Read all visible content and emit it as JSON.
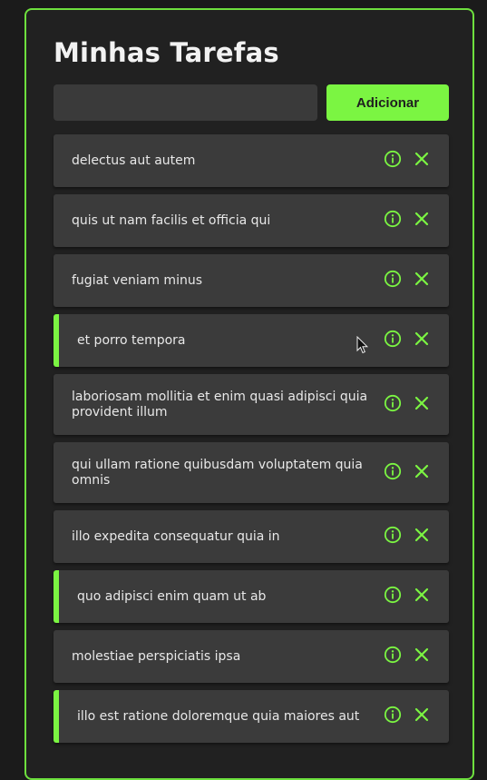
{
  "header": {
    "title": "Minhas Tarefas"
  },
  "form": {
    "input_value": "",
    "input_placeholder": "",
    "add_label": "Adicionar"
  },
  "tasks": [
    {
      "text": "delectus aut autem",
      "completed": false
    },
    {
      "text": "quis ut nam facilis et officia qui",
      "completed": false
    },
    {
      "text": "fugiat veniam minus",
      "completed": false
    },
    {
      "text": "et porro tempora",
      "completed": true
    },
    {
      "text": "laboriosam mollitia et enim quasi adipisci quia provident illum",
      "completed": false
    },
    {
      "text": "qui ullam ratione quibusdam voluptatem quia omnis",
      "completed": false
    },
    {
      "text": "illo expedita consequatur quia in",
      "completed": false
    },
    {
      "text": "quo adipisci enim quam ut ab",
      "completed": true
    },
    {
      "text": "molestiae perspiciatis ipsa",
      "completed": false
    },
    {
      "text": "illo est ratione doloremque quia maiores aut",
      "completed": true
    }
  ],
  "icons": {
    "info": "info-circle-icon",
    "remove": "close-icon"
  },
  "colors": {
    "accent": "#7bf542",
    "card_border": "#6ee03e",
    "background": "#1b1b1b",
    "card": "#212121",
    "task": "#3b3b3b"
  }
}
